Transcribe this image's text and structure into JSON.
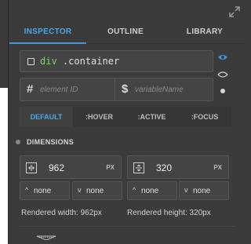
{
  "tabs": [
    {
      "label": "INSPECTOR",
      "active": true
    },
    {
      "label": "OUTLINE",
      "active": false
    },
    {
      "label": "LIBRARY",
      "active": false
    }
  ],
  "selector": {
    "tag": "div",
    "class": ".container"
  },
  "fields": {
    "element_id_prefix": "#",
    "element_id_placeholder": "element ID",
    "variable_prefix": "$",
    "variable_placeholder": "variableName"
  },
  "states": [
    {
      "label": "DEFAULT",
      "active": true
    },
    {
      "label": ":HOVER",
      "active": false
    },
    {
      "label": ":ACTIVE",
      "active": false
    },
    {
      "label": ":FOCUS",
      "active": false
    }
  ],
  "dimensions": {
    "title": "DIMENSIONS",
    "width": {
      "value": "962",
      "unit": "PX"
    },
    "height": {
      "value": "320",
      "unit": "PX"
    },
    "constraints": [
      "none",
      "none",
      "none",
      "none"
    ],
    "rendered_width": "Rendered width: 962px",
    "rendered_height": "Rendered height: 320px"
  },
  "icons": {
    "expand": "expand-icon",
    "visibility": "eye-icon",
    "visibility_outline": "eye-outline-icon",
    "state": "dot-icon",
    "width": "width-arrows-icon",
    "height": "height-arrows-icon",
    "grip": "resize-grip-icon"
  },
  "colors": {
    "accent": "#3d97da",
    "selector_tag": "#7cd36a",
    "panel_bg": "#3b3b3b"
  }
}
